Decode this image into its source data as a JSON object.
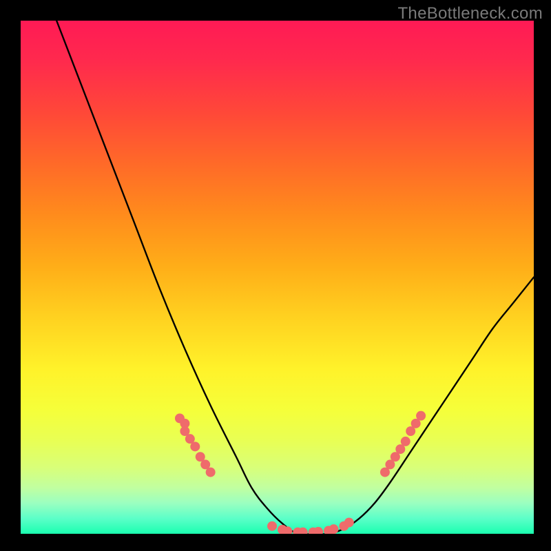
{
  "watermark": {
    "text": "TheBottleneck.com"
  },
  "chart_data": {
    "type": "line",
    "title": "",
    "xlabel": "",
    "ylabel": "",
    "xlim": [
      0,
      100
    ],
    "ylim": [
      0,
      100
    ],
    "grid": false,
    "legend": null,
    "series": [
      {
        "name": "bottleneck-curve",
        "x": [
          7,
          12,
          17,
          22,
          27,
          32,
          37,
          42,
          45,
          48,
          51,
          54,
          57,
          60,
          63,
          66,
          69,
          72,
          76,
          80,
          84,
          88,
          92,
          96,
          100
        ],
        "y": [
          100,
          87,
          74,
          61,
          48,
          36,
          25,
          15,
          9,
          5,
          2,
          0,
          0,
          0,
          1,
          3,
          6,
          10,
          16,
          22,
          28,
          34,
          40,
          45,
          50
        ]
      }
    ],
    "markers": [
      {
        "name": "marker-cluster-left",
        "color": "#ef6b6b",
        "points": [
          {
            "x": 31,
            "y": 22.5
          },
          {
            "x": 32,
            "y": 21.5
          },
          {
            "x": 32,
            "y": 20
          },
          {
            "x": 33,
            "y": 18.5
          },
          {
            "x": 34,
            "y": 17
          },
          {
            "x": 35,
            "y": 15
          },
          {
            "x": 36,
            "y": 13.5
          },
          {
            "x": 37,
            "y": 12
          }
        ]
      },
      {
        "name": "marker-cluster-bottom",
        "color": "#ef6b6b",
        "points": [
          {
            "x": 49,
            "y": 1.5
          },
          {
            "x": 51,
            "y": 0.8
          },
          {
            "x": 52,
            "y": 0.5
          },
          {
            "x": 54,
            "y": 0.3
          },
          {
            "x": 55,
            "y": 0.3
          },
          {
            "x": 57,
            "y": 0.3
          },
          {
            "x": 58,
            "y": 0.4
          },
          {
            "x": 60,
            "y": 0.6
          },
          {
            "x": 61,
            "y": 0.9
          },
          {
            "x": 63,
            "y": 1.5
          },
          {
            "x": 64,
            "y": 2.2
          }
        ]
      },
      {
        "name": "marker-cluster-right",
        "color": "#ef6b6b",
        "points": [
          {
            "x": 71,
            "y": 12
          },
          {
            "x": 72,
            "y": 13.5
          },
          {
            "x": 73,
            "y": 15
          },
          {
            "x": 74,
            "y": 16.5
          },
          {
            "x": 75,
            "y": 18
          },
          {
            "x": 76,
            "y": 20
          },
          {
            "x": 77,
            "y": 21.5
          },
          {
            "x": 78,
            "y": 23
          }
        ]
      }
    ]
  }
}
